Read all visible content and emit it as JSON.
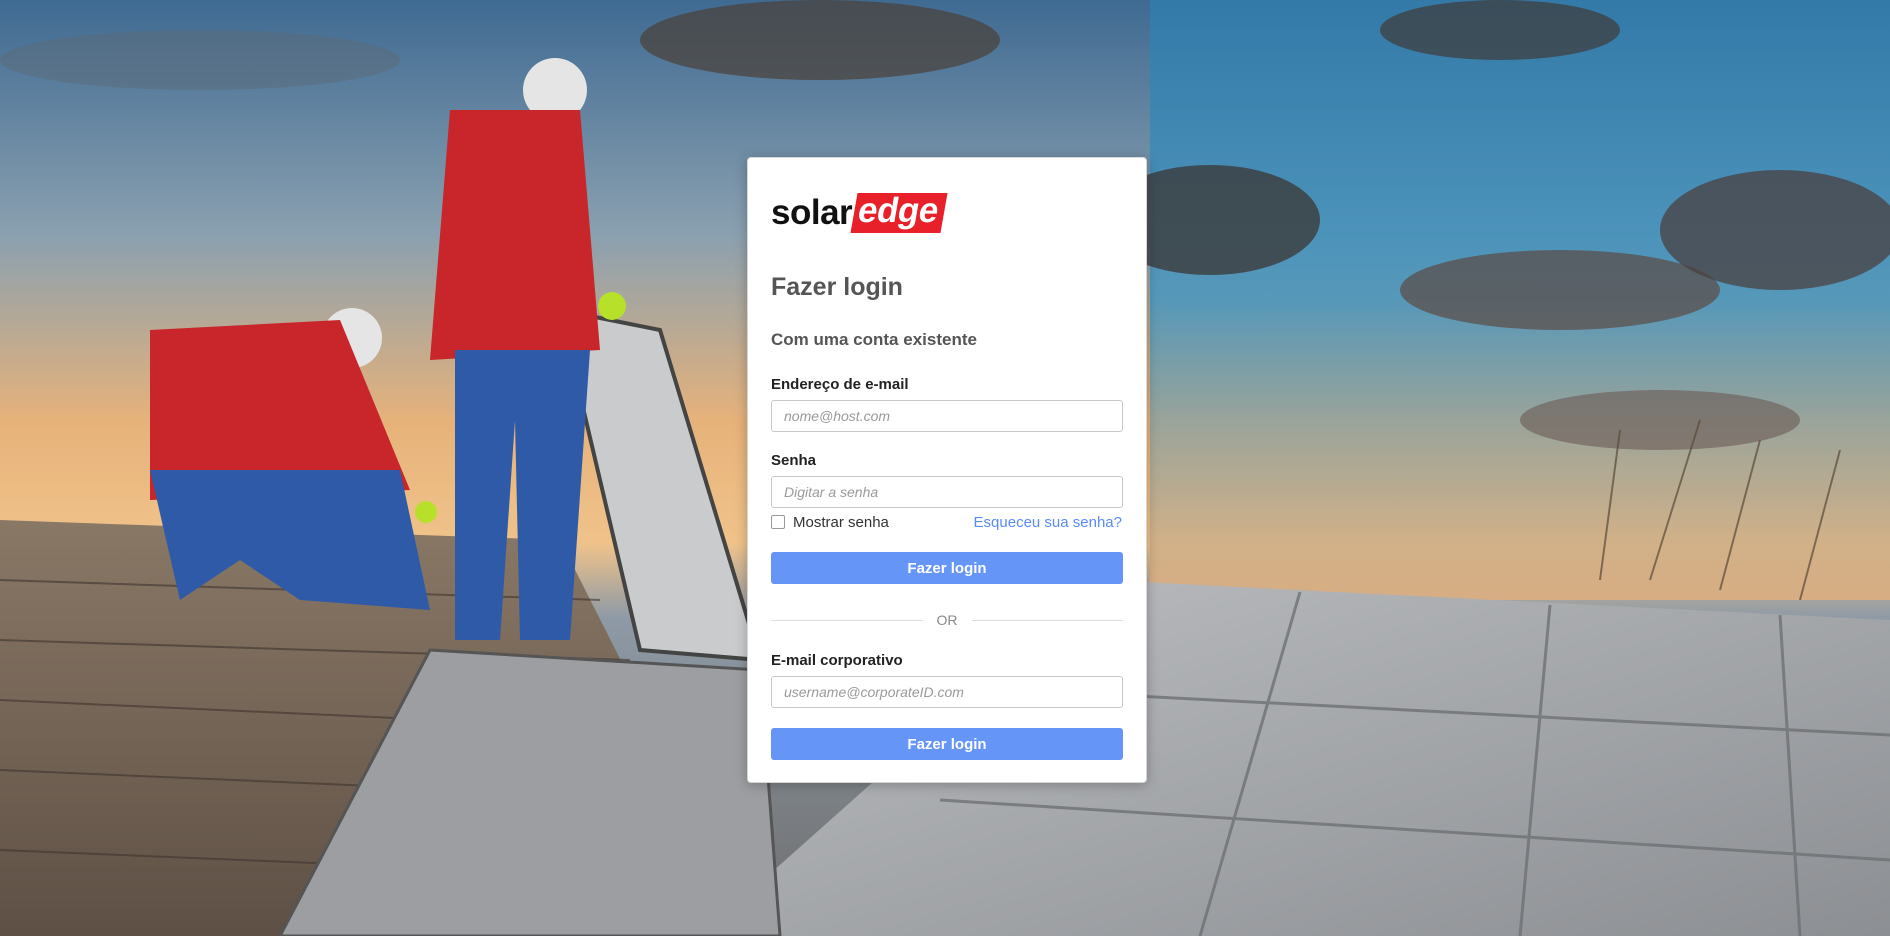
{
  "brand": {
    "logo_part1": "solar",
    "logo_part2": "edge",
    "accent_color": "#e8202a"
  },
  "login": {
    "title": "Fazer login",
    "subtitle": "Com uma conta existente",
    "email_label": "Endereço de e-mail",
    "email_placeholder": "nome@host.com",
    "password_label": "Senha",
    "password_placeholder": "Digitar a senha",
    "show_password_label": "Mostrar senha",
    "forgot_password_link": "Esqueceu sua senha?",
    "login_button": "Fazer login",
    "button_color": "#6495f7"
  },
  "divider": {
    "text": "OR"
  },
  "corporate": {
    "email_label": "E-mail corporativo",
    "email_placeholder": "username@corporateID.com",
    "login_button": "Fazer login"
  }
}
